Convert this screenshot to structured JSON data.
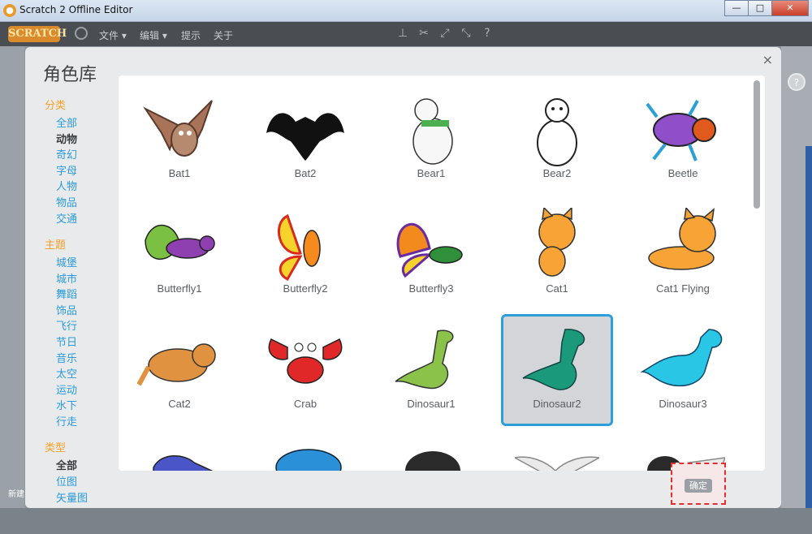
{
  "window": {
    "title": "Scratch 2 Offline Editor",
    "min": "—",
    "max": "□",
    "close": "✕"
  },
  "menubar": {
    "logo": "SCRATCH",
    "items": [
      "文件 ▾",
      "编辑 ▾",
      "提示",
      "关于"
    ]
  },
  "dialog": {
    "title": "角色库",
    "close": "×",
    "sections": [
      {
        "header": "分类",
        "items": [
          "全部",
          "动物",
          "奇幻",
          "字母",
          "人物",
          "物品",
          "交通"
        ],
        "selected": "动物"
      },
      {
        "header": "主题",
        "items": [
          "城堡",
          "城市",
          "舞蹈",
          "饰品",
          "飞行",
          "节日",
          "音乐",
          "太空",
          "运动",
          "水下",
          "行走"
        ],
        "selected": ""
      },
      {
        "header": "类型",
        "items": [
          "全部",
          "位图",
          "矢量图"
        ],
        "selected": "全部"
      }
    ],
    "sprites": [
      "Bat1",
      "Bat2",
      "Bear1",
      "Bear2",
      "Beetle",
      "Butterfly1",
      "Butterfly2",
      "Butterfly3",
      "Cat1",
      "Cat1 Flying",
      "Cat2",
      "Crab",
      "Dinosaur1",
      "Dinosaur2",
      "Dinosaur3"
    ],
    "selected_sprite": "Dinosaur2",
    "ok": "确定"
  },
  "side": {
    "help": "?",
    "new_sprite": "新建"
  },
  "colors": {
    "accent": "#2aa0d6",
    "header": "#f2a126",
    "link": "#2c9ad8"
  }
}
